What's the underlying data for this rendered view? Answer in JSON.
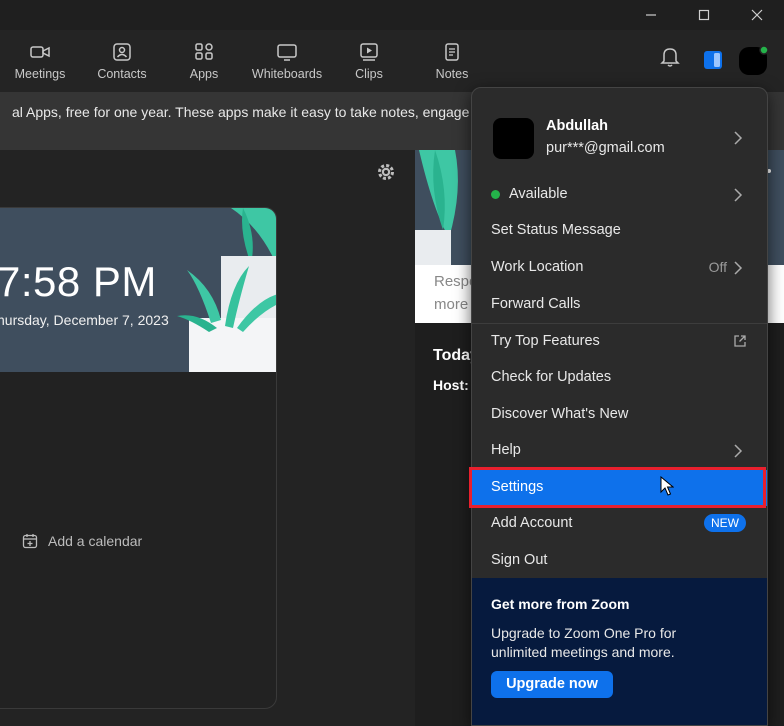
{
  "window": {
    "minimize": "—",
    "maximize": "☐",
    "close": "✕"
  },
  "nav": {
    "items": [
      {
        "label": "Meetings",
        "icon": "video-camera-icon"
      },
      {
        "label": "Contacts",
        "icon": "contacts-icon"
      },
      {
        "label": "Apps",
        "icon": "apps-icon"
      },
      {
        "label": "Whiteboards",
        "icon": "whiteboard-icon"
      },
      {
        "label": "Clips",
        "icon": "clips-icon"
      },
      {
        "label": "Notes",
        "icon": "notes-icon"
      }
    ]
  },
  "banner": {
    "text": "al Apps, free for one year. These apps make it easy to take notes, engage yo"
  },
  "clock": {
    "time": "7:58 PM",
    "date": "hursday, December 7, 2023"
  },
  "calendar": {
    "add_label": "Add a calendar"
  },
  "right": {
    "line1": "Respo",
    "line2": "more",
    "today": "Today",
    "host": "Host:"
  },
  "menu": {
    "profile": {
      "name": "Abdullah",
      "email": "pur***@gmail.com"
    },
    "status": "Available",
    "set_status": "Set Status Message",
    "work_location": "Work Location",
    "work_location_value": "Off",
    "forward_calls": "Forward Calls",
    "try_top": "Try Top Features",
    "check_updates": "Check for Updates",
    "discover": "Discover What's New",
    "help": "Help",
    "settings": "Settings",
    "add_account": "Add Account",
    "new_badge": "NEW",
    "sign_out": "Sign Out"
  },
  "promo": {
    "title": "Get more from Zoom",
    "body": "Upgrade to Zoom One Pro for unlimited meetings and more.",
    "button": "Upgrade now"
  },
  "colors": {
    "accent": "#0e71eb",
    "highlight": "#e8202e",
    "status_green": "#24b34a",
    "promo_bg": "#061a3e"
  }
}
